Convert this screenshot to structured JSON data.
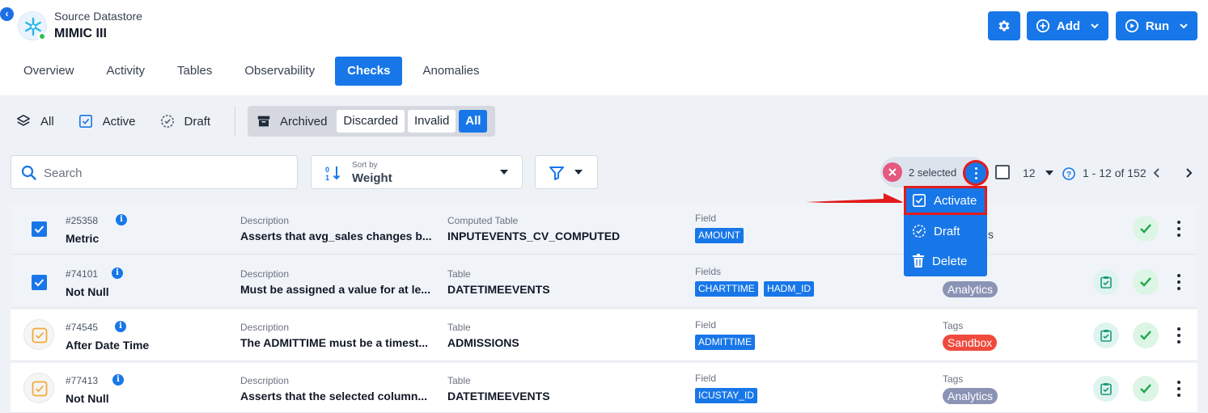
{
  "header": {
    "datastore_type": "Source Datastore",
    "datastore_name": "MIMIC III",
    "add_label": "Add",
    "run_label": "Run"
  },
  "tabs": [
    {
      "label": "Overview",
      "active": false
    },
    {
      "label": "Activity",
      "active": false
    },
    {
      "label": "Tables",
      "active": false
    },
    {
      "label": "Observability",
      "active": false
    },
    {
      "label": "Checks",
      "active": true
    },
    {
      "label": "Anomalies",
      "active": false
    }
  ],
  "status_filters": {
    "all": "All",
    "active": "Active",
    "draft": "Draft",
    "archived": "Archived",
    "discarded": "Discarded",
    "invalid": "Invalid",
    "archived_all": "All"
  },
  "toolbar": {
    "search_placeholder": "Search",
    "sort_by_label": "Sort by",
    "sort_value": "Weight",
    "selected_text": "2 selected",
    "per_page": "12",
    "pagination": "1 - 12 of 152"
  },
  "menu": {
    "activate": "Activate",
    "draft": "Draft",
    "delete": "Delete"
  },
  "rows": [
    {
      "id": "#25358",
      "name": "Metric",
      "desc_label": "Description",
      "desc": "Asserts that avg_sales changes b...",
      "table_label": "Computed Table",
      "table": "INPUTEVENTS_CV_COMPUTED",
      "field_label": "Field",
      "fields": [
        "AMOUNT"
      ],
      "tags_label": "",
      "tags": [],
      "selected": true
    },
    {
      "id": "#74101",
      "name": "Not Null",
      "desc_label": "Description",
      "desc": "Must be assigned a value for at le...",
      "table_label": "Table",
      "table": "DATETIMEEVENTS",
      "field_label": "Fields",
      "fields": [
        "CHARTTIME",
        "HADM_ID"
      ],
      "tags_label": "",
      "tags": [
        "Analytics"
      ],
      "selected": true
    },
    {
      "id": "#74545",
      "name": "After Date Time",
      "desc_label": "Description",
      "desc": "The ADMITTIME must be a timest...",
      "table_label": "Table",
      "table": "ADMISSIONS",
      "field_label": "Field",
      "fields": [
        "ADMITTIME"
      ],
      "tags_label": "Tags",
      "tags": [
        "Sandbox"
      ],
      "selected": false
    },
    {
      "id": "#77413",
      "name": "Not Null",
      "desc_label": "Description",
      "desc": "Asserts that the selected column...",
      "table_label": "Table",
      "table": "DATETIMEEVENTS",
      "field_label": "Field",
      "fields": [
        "ICUSTAY_ID"
      ],
      "tags_label": "Tags",
      "tags": [
        "Analytics"
      ],
      "selected": false
    }
  ],
  "row0_partial_tag_text": "s",
  "colors": {
    "primary": "#1877e8",
    "danger": "#e31b1b",
    "success": "#2fbf4d"
  }
}
